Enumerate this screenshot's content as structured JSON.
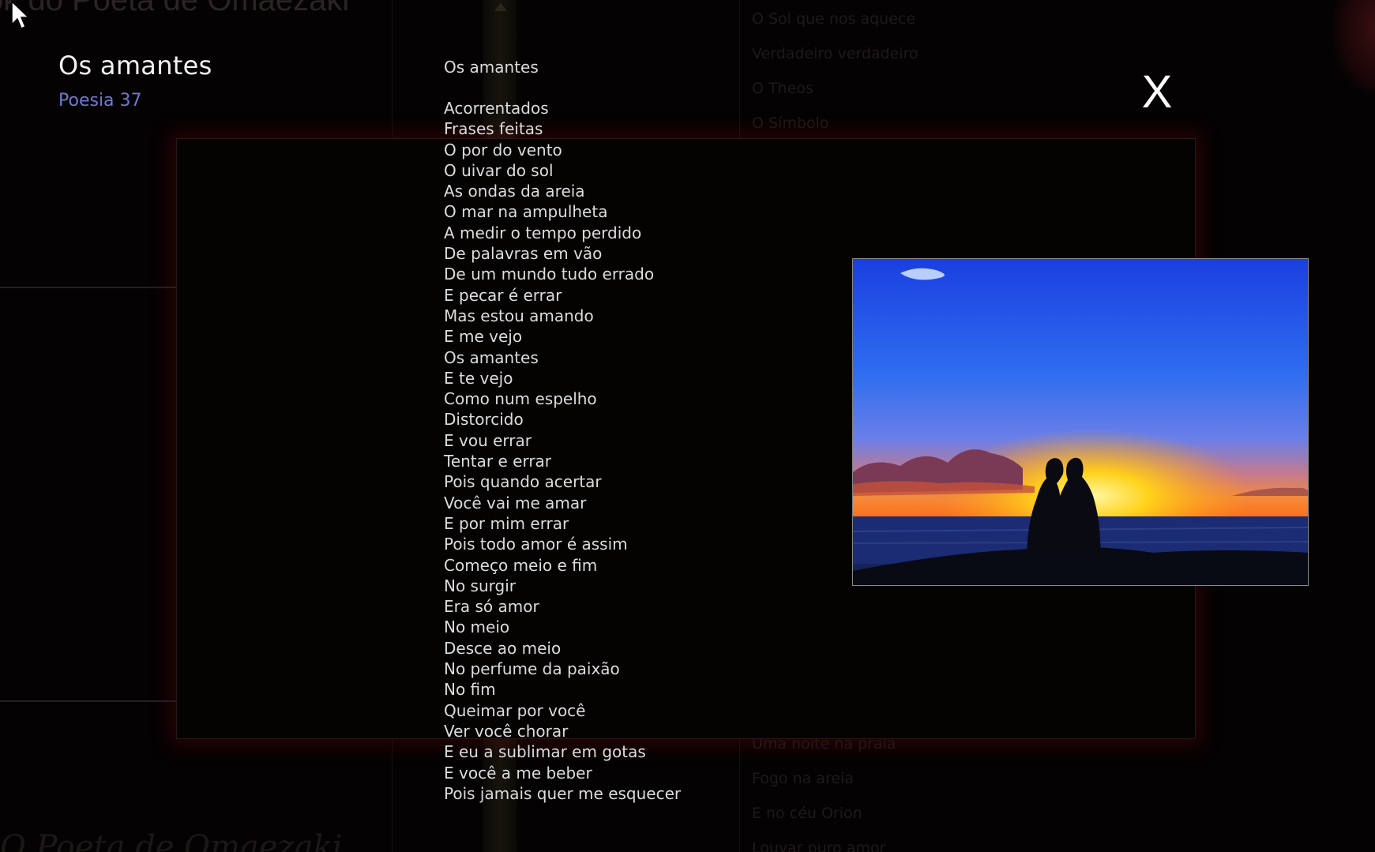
{
  "background": {
    "header_text": "ok do Poeta de Omaezaki",
    "footer_text": "O Poeta de Omaezaki",
    "list_top": [
      "O Sol que nos aquece",
      "Verdadeiro  verdadeiro",
      "O Theos",
      "O Símbolo"
    ],
    "list_bottom": [
      "Uma noite na praia",
      "Fogo na areia",
      "E no céu Orion",
      "Louvar puro amor"
    ]
  },
  "poem": {
    "title": "Os amantes",
    "subtitle": "Poesia 37",
    "heading": "Os amantes",
    "lines": [
      "Acorrentados",
      "Frases feitas",
      "O por do vento",
      "O uivar do sol",
      "As ondas da areia",
      "O mar na ampulheta",
      "A medir o tempo perdido",
      "De palavras em vão",
      "De um mundo tudo errado",
      "E pecar é errar",
      "Mas estou amando",
      "E me vejo",
      "Os amantes",
      "E te vejo",
      "Como num espelho",
      "Distorcido",
      "E vou errar",
      "Tentar e errar",
      "Pois quando acertar",
      "Você vai me amar",
      "E por mim errar",
      "Pois todo amor é assim",
      "Começo meio e fim",
      "No surgir",
      "Era só amor",
      "No meio",
      "Desce ao meio",
      "No perfume da paixão",
      "No fim",
      "Queimar por você",
      "Ver você chorar",
      "E eu a sublimar em gotas",
      "E você a me beber",
      "Pois jamais quer me esquecer"
    ]
  },
  "close": {
    "label": "X"
  },
  "icons": {
    "cursor": "mouse-pointer-icon",
    "photo": "sunset-couple-photo"
  },
  "colors": {
    "background": "#050203",
    "title": "#f2f2f2",
    "subtitle": "#6f78d2",
    "poem_text": "#dcdcdc",
    "dialog_glow": "#640a0a"
  }
}
